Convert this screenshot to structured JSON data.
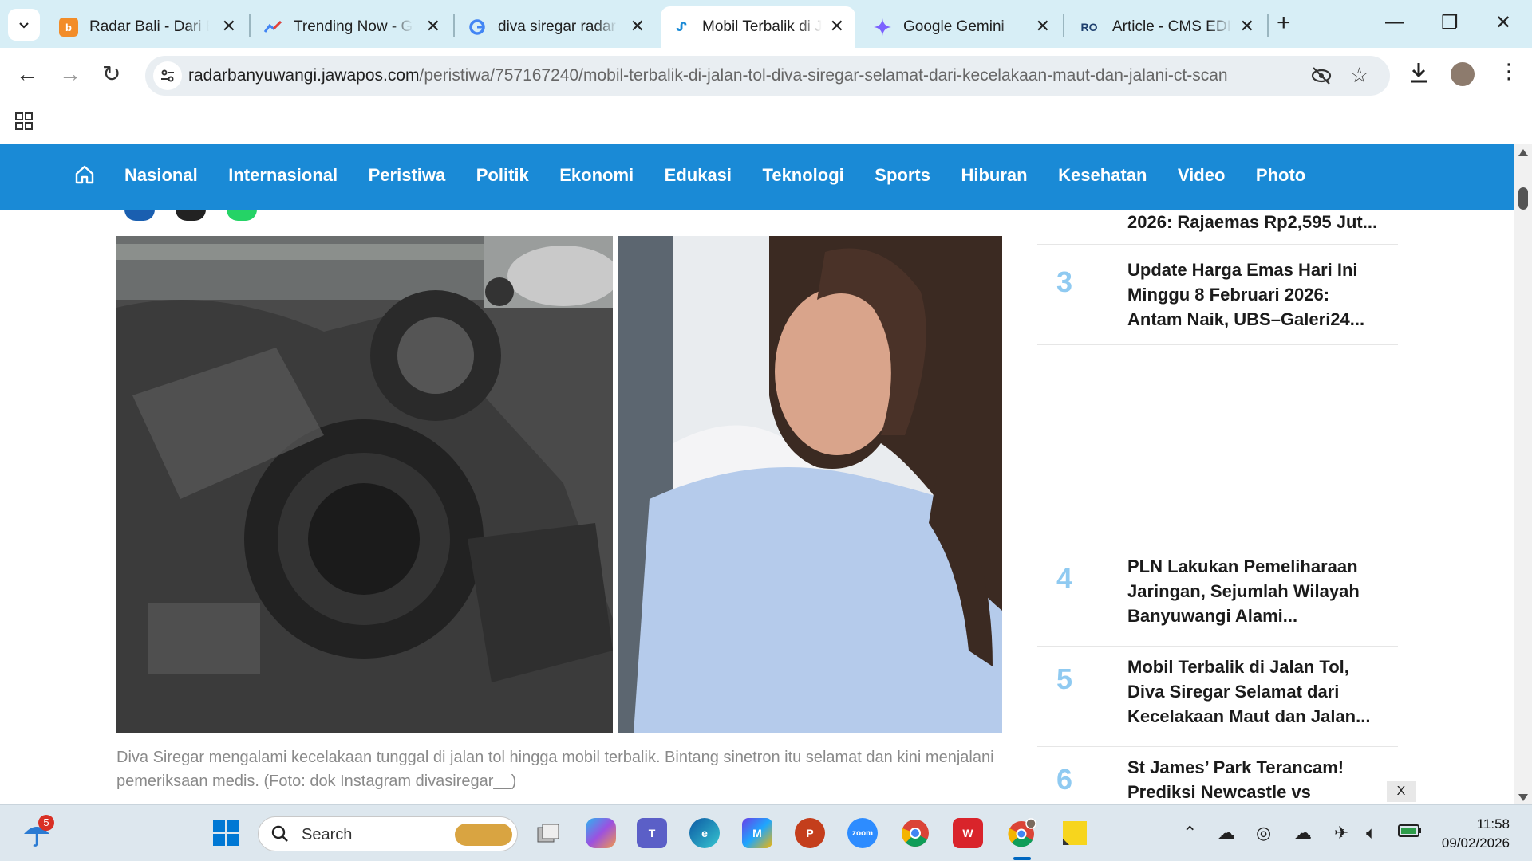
{
  "browser": {
    "tabs": [
      {
        "title": "Radar Bali - Dari Bali untuk Indonesia",
        "favicon": "radar-bali-icon",
        "color": "#f28c28"
      },
      {
        "title": "Trending Now - Google Trends",
        "favicon": "google-trends-icon",
        "color": "#34a853"
      },
      {
        "title": "diva siregar radar banyuwangi - Google Search",
        "favicon": "google-icon",
        "color": "#4285f4"
      },
      {
        "title": "Mobil Terbalik di Jalan Tol, Diva Siregar",
        "favicon": "jawapos-icon",
        "color": "#1a8ad6"
      },
      {
        "title": "Google Gemini",
        "favicon": "gemini-icon",
        "color": "#7b61ff"
      },
      {
        "title": "Article - CMS EDITOR",
        "favicon": "cms-icon",
        "color": "#1e3f6e"
      }
    ],
    "active_tab_index": 3,
    "url_host": "radarbanyuwangi.jawapos.com",
    "url_path": "/peristiwa/757167240/mobil-terbalik-di-jalan-tol-diva-siregar-selamat-dari-kecelakaan-maut-dan-jalani-ct-scan"
  },
  "site_nav": {
    "items": [
      "Nasional",
      "Internasional",
      "Peristiwa",
      "Politik",
      "Ekonomi",
      "Edukasi",
      "Teknologi",
      "Sports",
      "Hiburan",
      "Kesehatan",
      "Video",
      "Photo"
    ],
    "background": "#1a8ad6"
  },
  "article": {
    "photo_left_alt": "overturned car wreckage",
    "photo_right_alt": "woman in light blue top",
    "caption": "Diva Siregar mengalami kecelakaan tunggal di jalan tol hingga mobil terbalik. Bintang sinetron itu selamat dan kini menjalani pemeriksaan medis. (Foto: dok Instagram divasiregar__)"
  },
  "sidebar": {
    "partial_item": "2026: Rajaemas Rp2,595 Jut...",
    "ranked": [
      {
        "num": "3",
        "title": "Update Harga Emas Hari Ini Minggu 8 Februari 2026: Antam Naik, UBS–Galeri24..."
      },
      {
        "num": "4",
        "title": "PLN Lakukan Pemeliharaan Jaringan, Sejumlah Wilayah Banyuwangi Alami..."
      },
      {
        "num": "5",
        "title": "Mobil Terbalik di Jalan Tol, Diva Siregar Selamat dari Kecelakaan Maut dan Jalan..."
      },
      {
        "num": "6",
        "title": "St James’ Park Terancam! Prediksi Newcastle vs"
      }
    ],
    "close_label": "X"
  },
  "taskbar": {
    "search_placeholder": "Search",
    "notification_count": "5",
    "time": "11:58",
    "date": "09/02/2026"
  }
}
